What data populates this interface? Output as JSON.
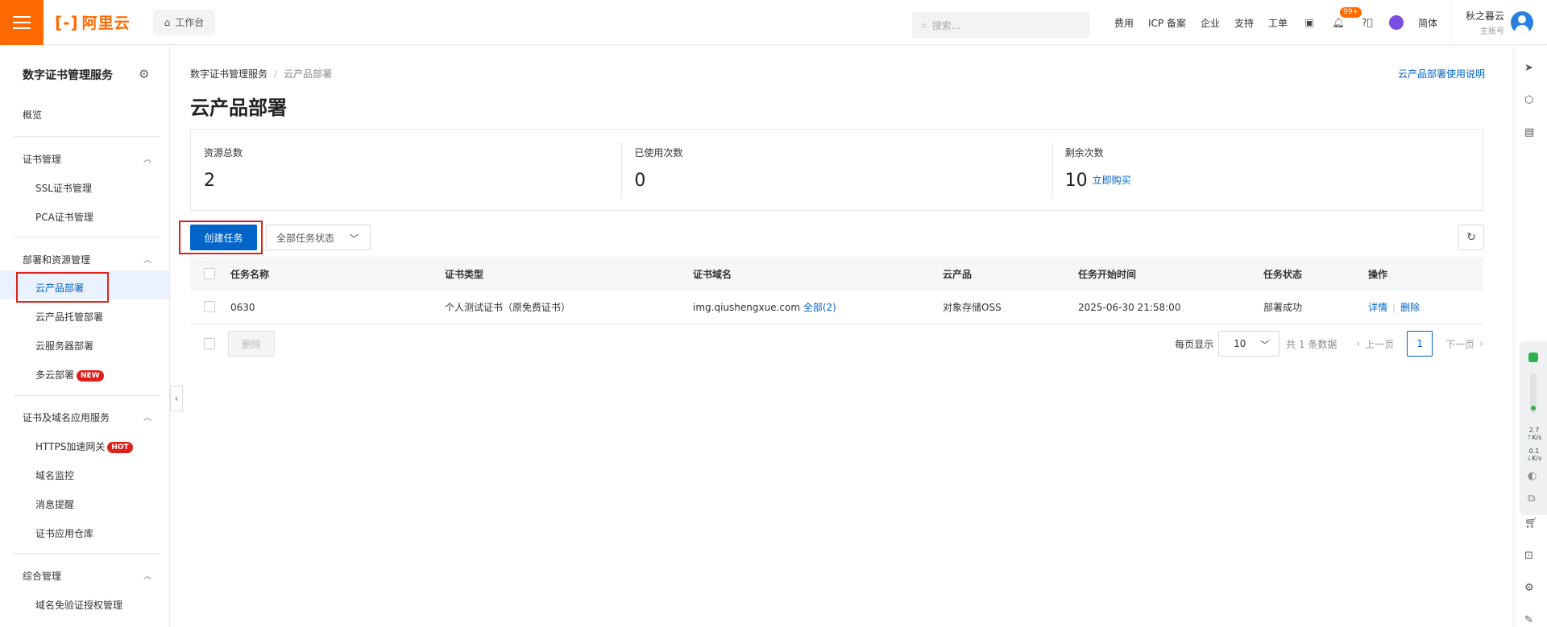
{
  "header": {
    "logo_text": "阿里云",
    "workbench_label": "工作台",
    "search_placeholder": "搜索...",
    "nav": [
      "费用",
      "ICP 备案",
      "企业",
      "支持",
      "工单"
    ],
    "notification_badge": "99+",
    "language": "简体",
    "user_name": "秋之暮云",
    "user_role": "主账号",
    "brand_color": "#ff6a00"
  },
  "sidebar": {
    "title": "数字证书管理服务",
    "overview": "概览",
    "groups": [
      {
        "label": "证书管理",
        "items": [
          "SSL证书管理",
          "PCA证书管理"
        ]
      },
      {
        "label": "部署和资源管理",
        "items": [
          "云产品部署",
          "云产品托管部署",
          "云服务器部署",
          "多云部署"
        ]
      },
      {
        "label": "证书及域名应用服务",
        "items": [
          "HTTPS加速网关",
          "域名监控",
          "消息提醒",
          "证书应用仓库"
        ]
      },
      {
        "label": "综合管理",
        "items": [
          "域名免验证授权管理"
        ]
      }
    ],
    "tag_new": "NEW",
    "tag_hot": "HOT",
    "active_item": "云产品部署"
  },
  "breadcrumb": {
    "parent": "数字证书管理服务",
    "current": "云产品部署"
  },
  "help_link": "云产品部署使用说明",
  "page_title": "云产品部署",
  "stats": [
    {
      "label": "资源总数",
      "value": "2"
    },
    {
      "label": "已使用次数",
      "value": "0"
    },
    {
      "label": "剩余次数",
      "value": "10",
      "action": "立即购买"
    }
  ],
  "toolbar": {
    "create_label": "创建任务",
    "status_filter": "全部任务状态"
  },
  "table": {
    "columns": [
      "任务名称",
      "证书类型",
      "证书域名",
      "云产品",
      "任务开始时间",
      "任务状态",
      "操作"
    ],
    "rows": [
      {
        "name": "0630",
        "cert_type": "个人测试证书（原免费证书）",
        "domain": "img.qiushengxue.com",
        "domain_all": "全部(2)",
        "product": "对象存储OSS",
        "start_time": "2025-06-30 21:58:00",
        "status": "部署成功",
        "op_detail": "详情",
        "op_delete": "删除"
      }
    ]
  },
  "footer": {
    "delete_label": "删除",
    "page_size_label": "每页显示",
    "page_size": "10",
    "total": "共 1 条数据",
    "prev": "上一页",
    "current_page": "1",
    "next": "下一页"
  },
  "widget": {
    "up": "2.7",
    "up_unit": "K/s",
    "down": "0.1",
    "down_unit": "K/s"
  }
}
